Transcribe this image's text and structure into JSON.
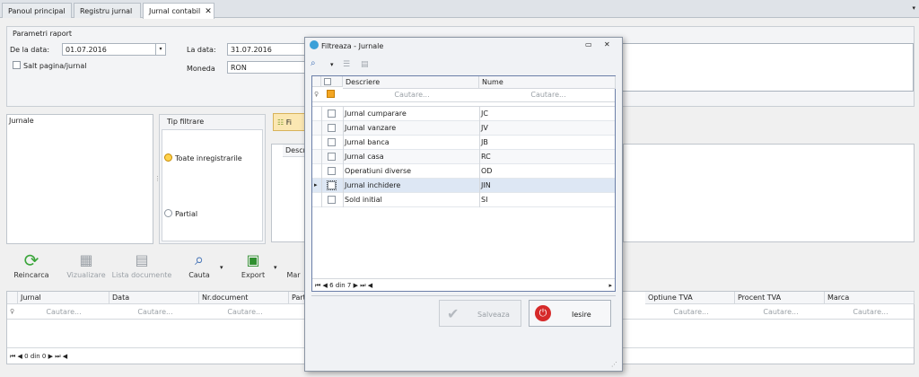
{
  "tabs": [
    {
      "label": "Panoul principal"
    },
    {
      "label": "Registru jurnal"
    },
    {
      "label": "Jurnal contabil",
      "close": "✕"
    }
  ],
  "params": {
    "title": "Parametri raport",
    "from_label": "De la data:",
    "from_value": "01.07.2016",
    "to_label": "La data:",
    "to_value": "31.07.2016",
    "page_break_label": "Salt pagina/jurnal",
    "currency_label": "Moneda",
    "currency_value": "RON"
  },
  "jurnale_label": "Jurnale",
  "filter": {
    "title": "Tip filtrare",
    "option_all": "Toate inregistrarile",
    "option_partial": "Partial"
  },
  "mid_grid_header": "Descri",
  "mid_button_partial": "Fi",
  "toolbar": {
    "reload": "Reincarca",
    "view": "Vizualizare",
    "doc_list": "Lista documente",
    "search": "Cauta",
    "export": "Export",
    "more": "Mar"
  },
  "main_grid": {
    "columns": [
      "Jurnal",
      "Data",
      "Nr.document",
      "Part",
      "Optiune TVA",
      "Procent TVA",
      "Marca"
    ],
    "search_placeholder": "Cautare..."
  },
  "main_nav": {
    "first": "⏮",
    "prev": "◀",
    "info": "0 din 0",
    "next": "▶",
    "last": "⏭",
    "extra": "◀"
  },
  "dialog": {
    "title": "Filtreaza - Jurnale",
    "columns": {
      "desc": "Descriere",
      "name": "Nume"
    },
    "search_placeholder": "Cautare...",
    "rows": [
      {
        "desc": "Jurnal cumparare",
        "name": "JC"
      },
      {
        "desc": "Jurnal vanzare",
        "name": "JV"
      },
      {
        "desc": "Jurnal banca",
        "name": "JB"
      },
      {
        "desc": "Jurnal casa",
        "name": "RC"
      },
      {
        "desc": "Operatiuni diverse",
        "name": "OD"
      },
      {
        "desc": "Jurnal inchidere",
        "name": "JIN"
      },
      {
        "desc": "Sold initial",
        "name": "SI"
      }
    ],
    "nav": {
      "first": "⏮",
      "prev": "◀",
      "info": "6 din 7",
      "next": "▶",
      "last": "⏭",
      "extra": "◀"
    },
    "save_label": "Salveaza",
    "exit_label": "Iesire"
  },
  "colors": {
    "accent": "#3f6fb5",
    "exit_red": "#d62a2a",
    "tab_bg": "#dfe3e8"
  }
}
